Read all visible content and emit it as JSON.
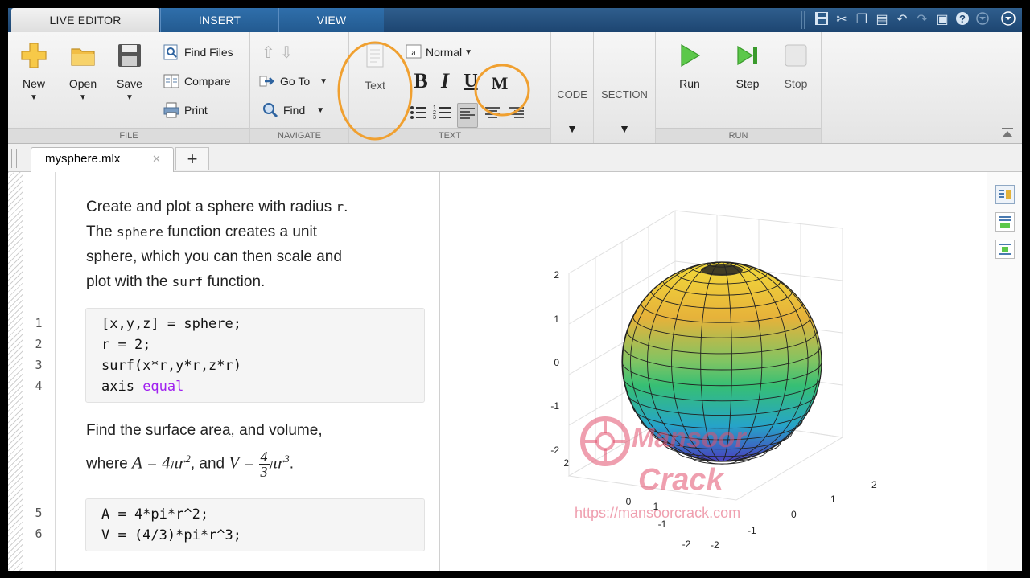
{
  "tabs": [
    {
      "label": "LIVE EDITOR",
      "active": true
    },
    {
      "label": "INSERT",
      "active": false
    },
    {
      "label": "VIEW",
      "active": false
    }
  ],
  "quick_access": [
    "save-icon",
    "cut-icon",
    "copy-icon",
    "paste-icon",
    "undo-icon",
    "redo-icon",
    "window-icon",
    "help-icon",
    "minimize-icon",
    "options-icon"
  ],
  "ribbon": {
    "file": {
      "group_label": "FILE",
      "new": "New",
      "open": "Open",
      "save": "Save",
      "find_files": "Find Files",
      "compare": "Compare",
      "print": "Print"
    },
    "navigate": {
      "group_label": "NAVIGATE",
      "go_to": "Go To",
      "find": "Find"
    },
    "text": {
      "group_label": "TEXT",
      "text_button": "Text",
      "style_select": "Normal",
      "bold": "B",
      "italic": "I",
      "underline": "U",
      "monospace": "M"
    },
    "code": {
      "label": "CODE"
    },
    "section": {
      "label": "SECTION"
    },
    "run": {
      "group_label": "RUN",
      "run": "Run",
      "step": "Step",
      "stop": "Stop"
    }
  },
  "document_tab": {
    "filename": "mysphere.mlx",
    "close": "✕",
    "add": "+"
  },
  "editor": {
    "intro_lines": [
      "Create and plot a sphere with radius ",
      "r",
      ".",
      "The ",
      "sphere",
      " function creates a unit",
      "sphere, which you can then scale and",
      "plot with the ",
      "surf",
      " function."
    ],
    "code_block_1": {
      "line_numbers": [
        "1",
        "2",
        "3",
        "4"
      ],
      "lines": [
        "[x,y,z] = sphere;",
        "r = 2;",
        "surf(x*r,y*r,z*r)",
        "axis "
      ],
      "keyword": "equal"
    },
    "formula_text": {
      "line1": "Find the surface area, and volume,",
      "where": "where ",
      "area_eq": "A = 4πr",
      "area_exp": "2",
      "and": ", and ",
      "volume_eq": "V =",
      "frac_num": "4",
      "frac_den": "3",
      "volume_tail": "πr",
      "volume_exp": "3",
      "period": "."
    },
    "code_block_2": {
      "line_numbers": [
        "5",
        "6"
      ],
      "lines": [
        "A = 4*pi*r^2;",
        "V = (4/3)*pi*r^3;"
      ]
    }
  },
  "plot": {
    "z_ticks": [
      "2",
      "1",
      "0",
      "-1",
      "-2"
    ],
    "x_ticks": [
      "2",
      "1",
      "0",
      "-1",
      "-2"
    ],
    "y_ticks": [
      "2",
      "1",
      "0",
      "-1",
      "-2"
    ],
    "colors": {
      "top": "#f2d93a",
      "upper": "#e6b23a",
      "mid": "#36bf74",
      "lower": "#26a4c8",
      "bottom": "#4a3fbf"
    }
  },
  "watermark": {
    "line1": "Mansoor",
    "line2": "Crack",
    "url": "https://mansoorcrack.com"
  },
  "highlight_color": "#f0a030"
}
